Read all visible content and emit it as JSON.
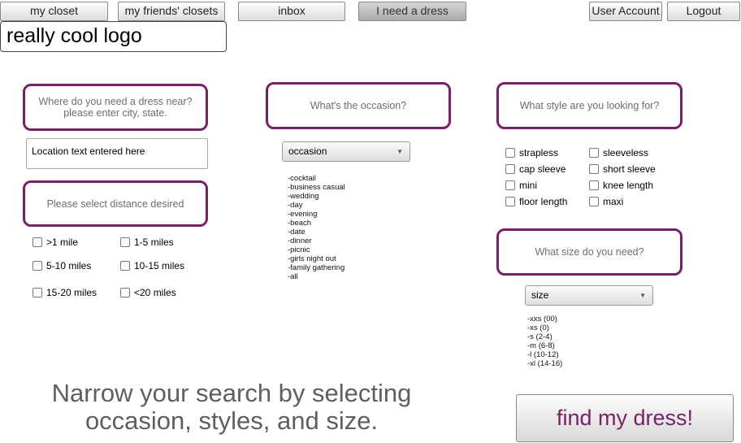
{
  "nav": {
    "my_closet": "my closet",
    "friends_closets": "my friends' closets",
    "inbox": "inbox",
    "need_dress": "I need a dress",
    "user_account": "User Account",
    "logout": "Logout"
  },
  "logo": "really cool logo",
  "location": {
    "prompt_line1": "Where do you need a dress near?",
    "prompt_line2": "please enter city, state.",
    "input_value": "Location text entered here"
  },
  "distance": {
    "prompt": "Please select distance desired",
    "options": [
      ">1 mile",
      "1-5 miles",
      "5-10 miles",
      "10-15 miles",
      "15-20 miles",
      "<20 miles"
    ]
  },
  "occasion": {
    "prompt": "What's the occasion?",
    "select_value": "occasion",
    "options": [
      "-cocktail",
      "-business casual",
      "-wedding",
      "-day",
      "-evening",
      "-beach",
      "-date",
      "-dinner",
      "-picnic",
      "-girls night out",
      "-family gathering",
      "-all"
    ]
  },
  "style": {
    "prompt": "What style are you looking for?",
    "options": [
      "strapless",
      "sleeveless",
      "cap sleeve",
      "short sleeve",
      "mini",
      "knee length",
      "floor length",
      "maxi"
    ]
  },
  "size": {
    "prompt": "What size do you need?",
    "select_value": "size",
    "options": [
      "-xxs (00)",
      "-xs (0)",
      "-s (2-4)",
      "-m (6-8)",
      "-l (10-12)",
      "-xl (14-16)"
    ]
  },
  "tagline_line1": "Narrow your search by selecting",
  "tagline_line2": "occasion, styles, and size.",
  "find_button": "find my dress!",
  "colors": {
    "accent": "#7b1f66",
    "prompt_text": "#6d6d6d",
    "tagline_text": "#5f5f5f"
  }
}
